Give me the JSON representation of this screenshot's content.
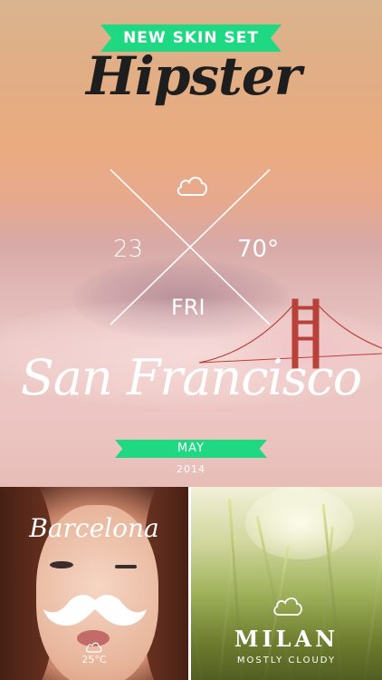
{
  "promo": {
    "ribbon": "NEW SKIN SET",
    "skin_name": "Hipster"
  },
  "main_weather": {
    "icon": "cloud-icon",
    "left_value": "23",
    "right_value": "70°",
    "day": "FRI",
    "city": "San Francisco",
    "month": "MAY",
    "year": "2014"
  },
  "tiles": [
    {
      "city": "Barcelona",
      "icon": "cloud-icon",
      "temperature": "25°C"
    },
    {
      "city": "MILAN",
      "icon": "cloud-icon",
      "condition": "MOSTLY CLOUDY"
    }
  ],
  "colors": {
    "accent_green": "#1ed982",
    "brand_text": "#1e1e1e",
    "bridge_red": "#b8423a"
  }
}
